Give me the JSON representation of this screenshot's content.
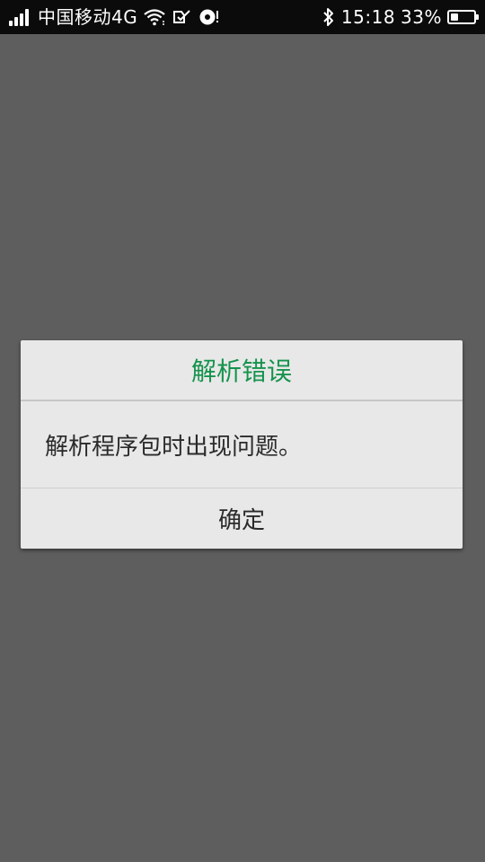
{
  "status_bar": {
    "carrier": "中国移动4G",
    "time": "15:18",
    "battery_percent": "33%",
    "battery_level": 0.33,
    "icons": [
      "signal-icon",
      "wifi-icon",
      "notification-icon",
      "sync-icon",
      "bluetooth-icon",
      "battery-icon"
    ]
  },
  "dialog": {
    "title": "解析错误",
    "message": "解析程序包时出现问题。",
    "ok_button": "确定"
  },
  "colors": {
    "overlay": "#5e5e5e",
    "dialog_bg": "#e8e8e8",
    "title": "#15934d",
    "text": "#2a2a2a",
    "status_bar": "#0b0b0b"
  }
}
